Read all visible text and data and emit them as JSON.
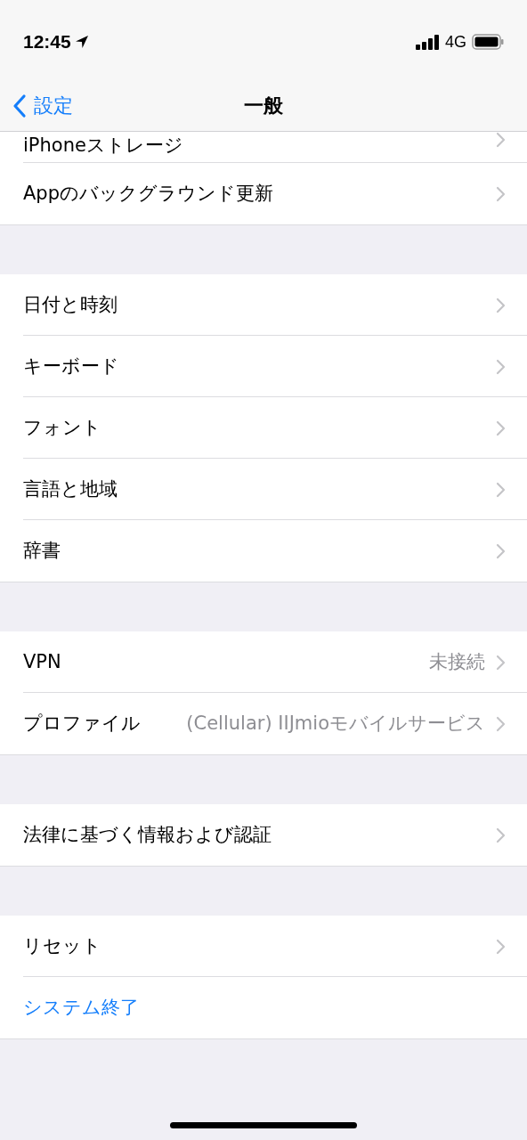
{
  "status_bar": {
    "time": "12:45",
    "network": "4G"
  },
  "nav": {
    "back": "設定",
    "title": "一般"
  },
  "groups": [
    {
      "rows": [
        {
          "label": "iPhoneストレージ",
          "kind": "cut"
        },
        {
          "label": "Appのバックグラウンド更新",
          "kind": "link"
        }
      ]
    },
    {
      "rows": [
        {
          "label": "日付と時刻",
          "kind": "link"
        },
        {
          "label": "キーボード",
          "kind": "link"
        },
        {
          "label": "フォント",
          "kind": "link"
        },
        {
          "label": "言語と地域",
          "kind": "link"
        },
        {
          "label": "辞書",
          "kind": "link"
        }
      ]
    },
    {
      "rows": [
        {
          "label": "VPN",
          "kind": "link",
          "value": "未接続"
        },
        {
          "label": "プロファイル",
          "kind": "link",
          "value": "(Cellular) IIJmioモバイルサービス"
        }
      ]
    },
    {
      "rows": [
        {
          "label": "法律に基づく情報および認証",
          "kind": "link"
        }
      ]
    },
    {
      "rows": [
        {
          "label": "リセット",
          "kind": "link"
        },
        {
          "label": "システム終了",
          "kind": "action"
        }
      ]
    }
  ]
}
